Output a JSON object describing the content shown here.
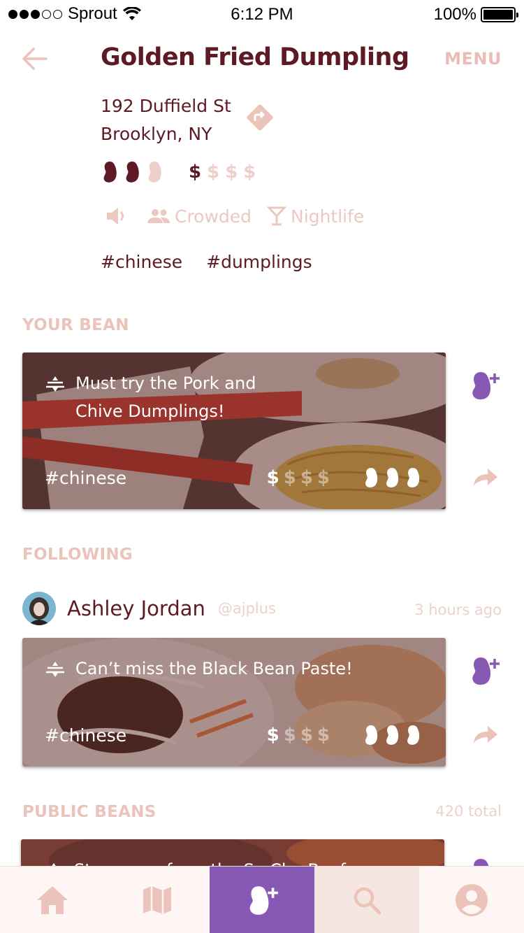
{
  "status_bar": {
    "carrier": "Sprout",
    "time": "6:12 PM",
    "battery": "100%"
  },
  "header": {
    "title": "Golden Fried Dumpling",
    "menu_label": "MENU"
  },
  "place": {
    "address_line1": "192 Duffield St",
    "address_line2": "Brooklyn, NY",
    "bean_rating": 2,
    "bean_max": 3,
    "price_level": 1,
    "price_max": 4,
    "price_symbol": "$",
    "attributes": {
      "crowd": "Crowded",
      "vibe": "Nightlife"
    },
    "tags": [
      "#chinese",
      "#dumplings"
    ]
  },
  "your_bean": {
    "section_label": "YOUR BEAN",
    "note": "Must try the Pork and Chive Dumplings!",
    "tag": "#chinese",
    "price_level": 1,
    "beans": 3
  },
  "following": {
    "section_label": "FOLLOWING",
    "user_name": "Ashley Jordan",
    "handle": "@ajplus",
    "time_ago": "3 hours ago",
    "note": "Can’t miss the Black Bean Paste!",
    "tag": "#chinese",
    "price_level": 1,
    "beans": 3
  },
  "public_beans": {
    "section_label": "PUBLIC BEANS",
    "total": "420 total",
    "note": "Stay away from the Sa Cha Beef"
  },
  "colors": {
    "brand_dark": "#5d1a24",
    "accent_light": "#ecc3bb",
    "purple": "#8758b4"
  },
  "tabbar": {
    "items": [
      "home-icon",
      "map-icon",
      "add-bean-icon",
      "search-icon",
      "profile-icon"
    ],
    "active": "add-bean-icon"
  }
}
